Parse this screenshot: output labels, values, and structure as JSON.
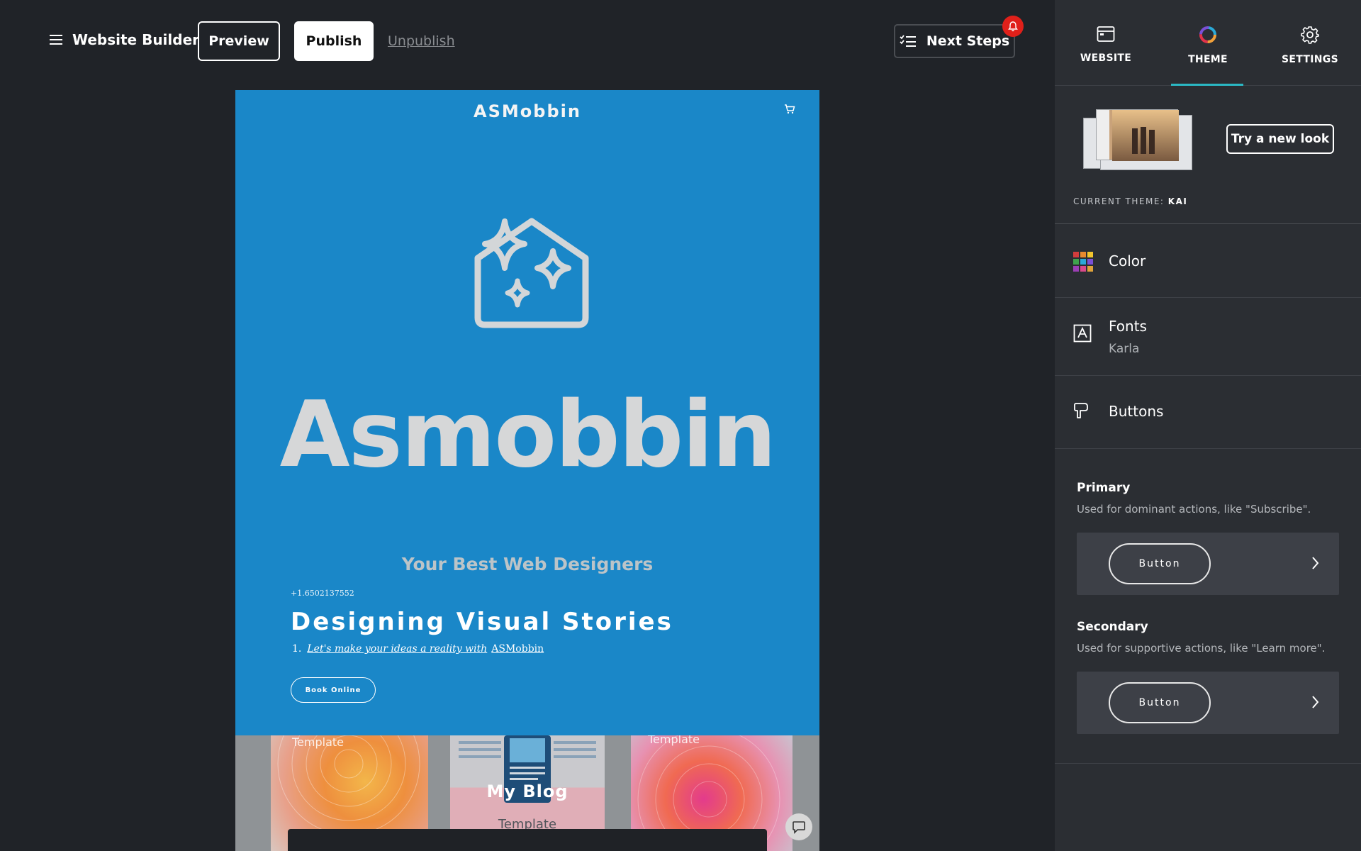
{
  "topbar": {
    "app_title": "Website Builder",
    "preview_label": "Preview",
    "publish_label": "Publish",
    "unpublish_label": "Unpublish",
    "next_steps_label": "Next Steps"
  },
  "site": {
    "name": "ASMobbin",
    "brand": "Asmobbin",
    "tagline": "Your Best Web Designers",
    "phone": "+1.6502137552",
    "hero_title": "Designing Visual Stories",
    "list_number": "1.",
    "list_link": "Let's make your ideas a reality with",
    "list_brand": "ASMobbin",
    "book_label": "Book Online",
    "card1_label": "Template",
    "card3_label": "Template",
    "blog_title": "My Blog",
    "blog_template": "Template"
  },
  "panel": {
    "tabs": [
      {
        "label": "WEBSITE"
      },
      {
        "label": "THEME"
      },
      {
        "label": "SETTINGS"
      }
    ],
    "try_new_look": "Try a new look",
    "current_theme_label": "CURRENT THEME:",
    "current_theme_value": "KAI",
    "color_label": "Color",
    "fonts_label": "Fonts",
    "fonts_value": "Karla",
    "buttons_label": "Buttons",
    "primary_title": "Primary",
    "primary_desc": "Used for dominant actions, like \"Subscribe\".",
    "primary_button": "Button",
    "secondary_title": "Secondary",
    "secondary_desc": "Used for supportive actions, like \"Learn more\".",
    "secondary_button": "Button"
  },
  "colors": {
    "hero_bg": "#1a87c8",
    "accent": "#2bb8c4",
    "badge": "#e0201a"
  }
}
